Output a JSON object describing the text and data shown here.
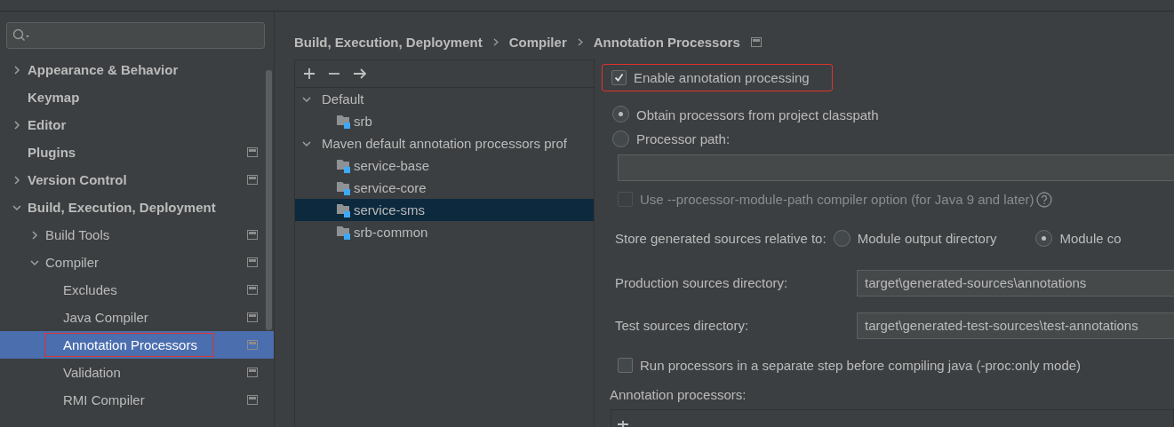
{
  "sidebar": {
    "items": [
      {
        "label": "Appearance & Behavior",
        "expanded": false,
        "selected": false,
        "highlighted": false,
        "project_level": false
      },
      {
        "label": "Keymap",
        "selected": false,
        "highlighted": false,
        "project_level": false
      },
      {
        "label": "Editor",
        "expanded": false,
        "selected": false,
        "highlighted": false,
        "project_level": false
      },
      {
        "label": "Plugins",
        "selected": false,
        "highlighted": false,
        "project_level": true
      },
      {
        "label": "Version Control",
        "expanded": false,
        "selected": false,
        "highlighted": false,
        "project_level": true
      },
      {
        "label": "Build, Execution, Deployment",
        "expanded": true,
        "selected": false,
        "highlighted": false,
        "project_level": false,
        "children": [
          {
            "label": "Build Tools",
            "expanded": false,
            "selected": false,
            "highlighted": false,
            "project_level": true
          },
          {
            "label": "Compiler",
            "expanded": true,
            "selected": false,
            "highlighted": false,
            "project_level": true,
            "children": [
              {
                "label": "Excludes",
                "selected": false,
                "highlighted": false,
                "project_level": true
              },
              {
                "label": "Java Compiler",
                "selected": false,
                "highlighted": false,
                "project_level": true
              },
              {
                "label": "Annotation Processors",
                "selected": true,
                "highlighted": true,
                "project_level": true
              },
              {
                "label": "Validation",
                "selected": false,
                "highlighted": false,
                "project_level": true
              },
              {
                "label": "RMI Compiler",
                "selected": false,
                "highlighted": false,
                "project_level": true
              }
            ]
          }
        ]
      }
    ]
  },
  "breadcrumb": [
    "Build, Execution, Deployment",
    "Compiler",
    "Annotation Processors"
  ],
  "profiles": {
    "items": [
      {
        "label": "Default",
        "expanded": true,
        "selected": false,
        "children": [
          {
            "label": "srb",
            "selected": false
          }
        ]
      },
      {
        "label": "Maven default annotation processors prof",
        "expanded": true,
        "selected": false,
        "children": [
          {
            "label": "service-base",
            "selected": false
          },
          {
            "label": "service-core",
            "selected": false
          },
          {
            "label": "service-sms",
            "selected": true
          },
          {
            "label": "srb-common",
            "selected": false
          }
        ]
      }
    ]
  },
  "settings": {
    "enable": {
      "label": "Enable annotation processing",
      "checked": true,
      "highlighted": true
    },
    "source_options": [
      {
        "label": "Obtain processors from project classpath",
        "selected": true
      },
      {
        "label": "Processor path:",
        "selected": false
      }
    ],
    "module_path_option": {
      "label": "Use --processor-module-path compiler option (for Java 9 and later)",
      "checked": false,
      "disabled": true
    },
    "store_relative": {
      "label": "Store generated sources relative to:",
      "options": [
        {
          "label": "Module output directory",
          "selected": false
        },
        {
          "label": "Module co",
          "selected": true
        }
      ]
    },
    "directories": [
      {
        "label": "Production sources directory:",
        "value": "target\\generated-sources\\annotations"
      },
      {
        "label": "Test sources directory:",
        "value": "target\\generated-test-sources\\test-annotations"
      }
    ],
    "run_separately": {
      "label": "Run processors in a separate step before compiling java (-proc:only mode)",
      "checked": false,
      "disabled": false
    },
    "annotation_processors": {
      "label": "Annotation processors:"
    }
  }
}
